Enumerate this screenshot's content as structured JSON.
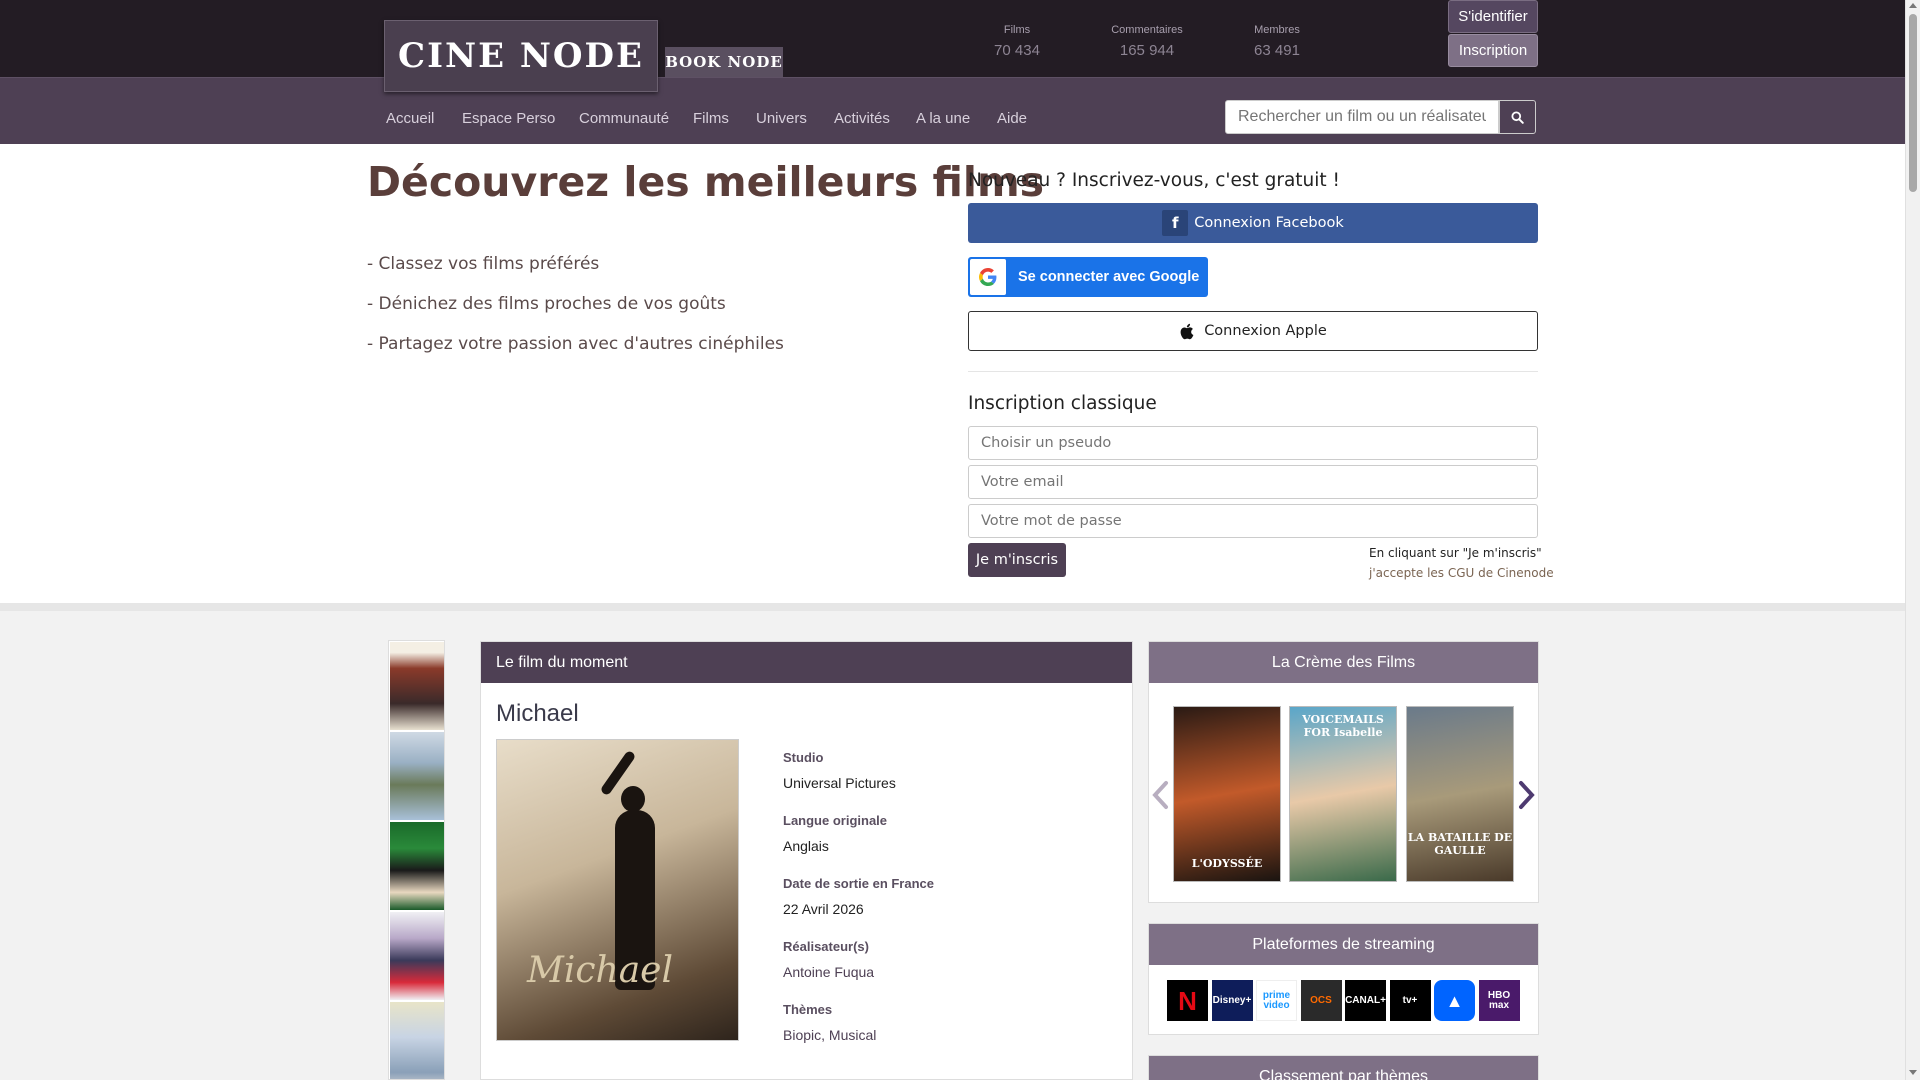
{
  "header": {
    "logo_text": "CINE NODE",
    "book_logo_text": "BOOK NODE",
    "stats": [
      {
        "label": "Films",
        "value": "70 434"
      },
      {
        "label": "Commentaires",
        "value": "165 944"
      },
      {
        "label": "Membres",
        "value": "63 491"
      }
    ],
    "login_label": "S'identifier",
    "signup_label": "Inscription"
  },
  "nav": {
    "items": [
      "Accueil",
      "Espace Perso",
      "Communauté",
      "Films",
      "Univers",
      "Activités",
      "A la une",
      "Aide"
    ],
    "search_placeholder": "Rechercher un film ou un réalisateur"
  },
  "hero": {
    "title": "Découvrez les meilleurs films",
    "points": [
      "- Classez vos films préférés",
      "- Dénichez des films proches de vos goûts",
      "- Partagez votre passion avec d'autres cinéphiles"
    ]
  },
  "signup": {
    "title": "Nouveau ? Inscrivez-vous, c'est gratuit !",
    "facebook_label": "Connexion Facebook",
    "google_label": "Se connecter avec Google",
    "apple_label": "Connexion Apple",
    "classic_title": "Inscription classique",
    "pseudo_placeholder": "Choisir un pseudo",
    "email_placeholder": "Votre email",
    "password_placeholder": "Votre mot de passe",
    "submit_label": "Je m'inscris",
    "cgu_line1": "En cliquant sur \"Je m'inscris\"",
    "cgu_line2": "j'accepte les CGU de Cinenode"
  },
  "film_du_moment": {
    "header": "Le film du moment",
    "title": "Michael",
    "poster_text": "Michael",
    "studio_label": "Studio",
    "studio": "Universal Pictures",
    "langue_label": "Langue originale",
    "langue": "Anglais",
    "date_label": "Date de sortie en France",
    "date": "22 Avril 2026",
    "realisateur_label": "Réalisateur(s)",
    "realisateur": "Antoine Fuqua",
    "themes_label": "Thèmes",
    "themes": [
      "Biopic",
      "Musical"
    ],
    "themes_sep": ", "
  },
  "creme": {
    "header": "La Crème des Films",
    "posters": [
      {
        "title": "L'ODYSSÉE",
        "colors": [
          "#2a1a14",
          "#c25a2a",
          "#1a1410"
        ]
      },
      {
        "title": "VOICEMAILS FOR Isabelle",
        "colors": [
          "#5aa6c9",
          "#e8c9a8",
          "#3a6a4a"
        ]
      },
      {
        "title": "LA BATAILLE DE GAULLE",
        "colors": [
          "#6a7a8a",
          "#a89a7a",
          "#4a3a2a"
        ]
      }
    ]
  },
  "streaming": {
    "header": "Plateformes de streaming",
    "logos": [
      {
        "name": "netflix-logo",
        "text": "N",
        "bg": "#000000",
        "fg": "#e50914"
      },
      {
        "name": "disney-plus-logo",
        "text": "Disney+",
        "bg": "#0e1d5a",
        "fg": "#ffffff"
      },
      {
        "name": "prime-video-logo",
        "text": "prime video",
        "bg": "#ffffff",
        "fg": "#1a98ff"
      },
      {
        "name": "ocs-logo",
        "text": "OCS",
        "bg": "#2a2a2a",
        "fg": "#ff6a00"
      },
      {
        "name": "canal-plus-logo",
        "text": "CANAL+",
        "bg": "#000000",
        "fg": "#ffffff"
      },
      {
        "name": "apple-tv-logo",
        "text": "tv+",
        "bg": "#000000",
        "fg": "#ffffff"
      },
      {
        "name": "paramount-plus-logo",
        "text": "▲",
        "bg": "#0064ff",
        "fg": "#ffffff"
      },
      {
        "name": "hbo-max-logo",
        "text": "HBO max",
        "bg": "#4a1a6a",
        "fg": "#ffffff"
      }
    ]
  },
  "themes_panel": {
    "header": "Classement par thèmes"
  },
  "colors": {
    "brand_dark": "#231c24",
    "brand_nav": "#4e4054",
    "brand_light": "#7e7086"
  }
}
